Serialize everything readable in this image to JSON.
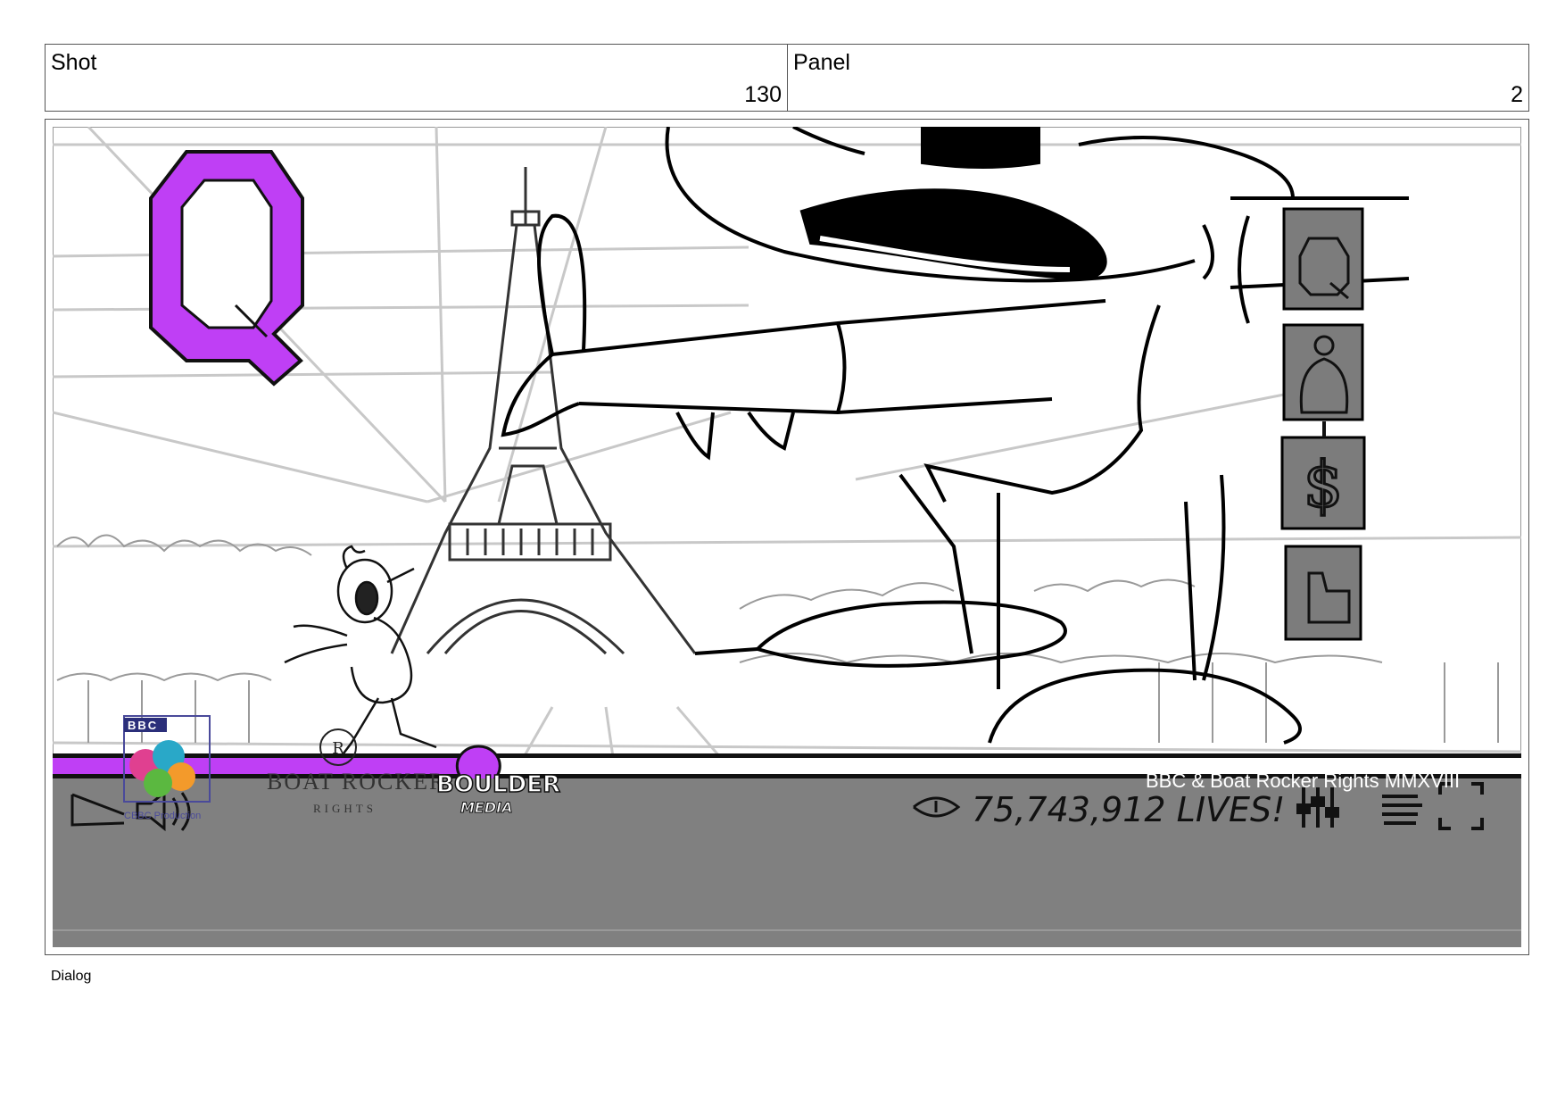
{
  "header": {
    "shot_label": "Shot",
    "shot_number": "130",
    "panel_label": "Panel",
    "panel_number": "2"
  },
  "player": {
    "big_letter": "Q",
    "view_count": "75,743,912 LIVES!",
    "copyright": "BBC & Boat Rocker Rights MMXVIII",
    "progress": 0.29,
    "side_icons": [
      "Q",
      "person-icon",
      "dollar-icon",
      "thumbs-up-icon"
    ]
  },
  "logos": {
    "bbc": "BBC",
    "cbbc_caption": "CBBC Production",
    "boat_rocker": "BOAT ROCKER",
    "boat_rocker_sub": "RIGHTS",
    "boulder": "BOULDER",
    "boulder_sub": "MEDIA"
  },
  "footer": {
    "dialog_label": "Dialog"
  },
  "colors": {
    "accent_purple": "#bf3ff5",
    "controls_bar": "#808080"
  }
}
